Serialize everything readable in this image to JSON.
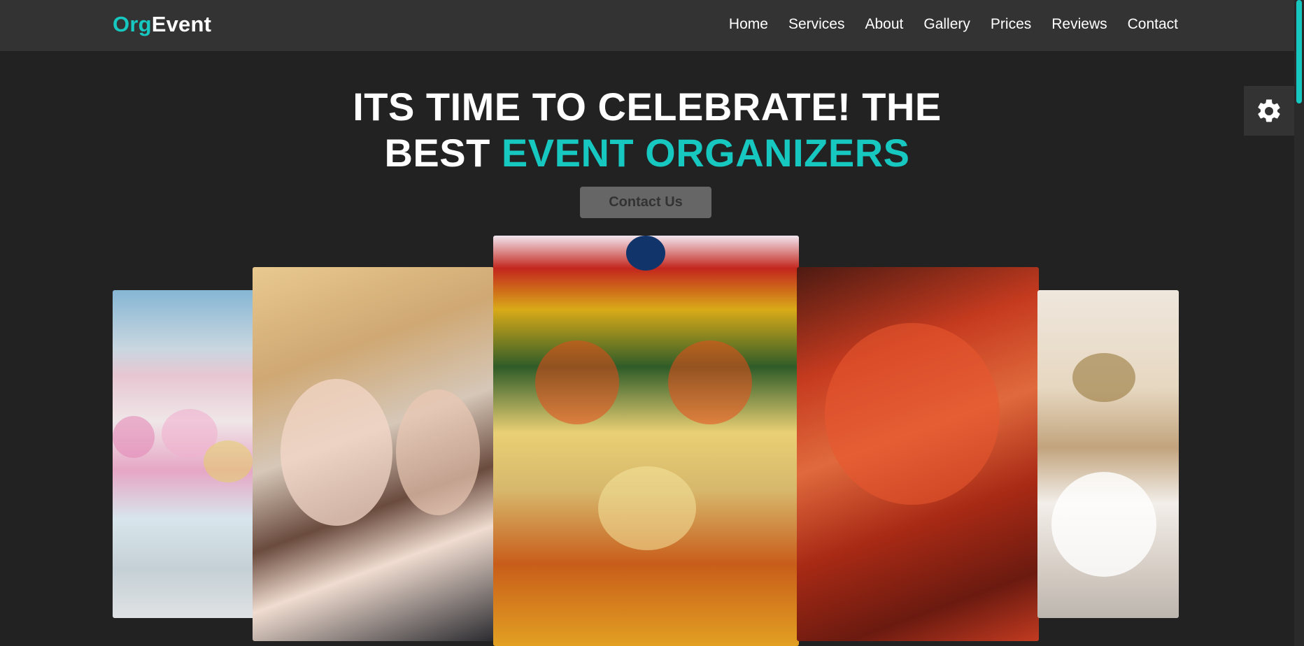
{
  "header": {
    "logo": {
      "part1": "Org",
      "part2": "Event"
    },
    "nav": [
      "Home",
      "Services",
      "About",
      "Gallery",
      "Prices",
      "Reviews",
      "Contact"
    ]
  },
  "hero": {
    "title_line1": "ITS TIME TO CELEBRATE! THE",
    "title_line2_plain": "BEST ",
    "title_line2_accent": "EVENT ORGANIZERS",
    "cta_label": "Contact Us"
  },
  "gallery": {
    "images": [
      "floral table decoration",
      "bride and groom under veil",
      "decorated floral wedding stage",
      "red fabric rose",
      "couple in ballroom"
    ]
  },
  "icons": {
    "settings": "gear-icon"
  },
  "colors": {
    "accent": "#16c8c0",
    "background": "#222222",
    "header": "#333333"
  }
}
